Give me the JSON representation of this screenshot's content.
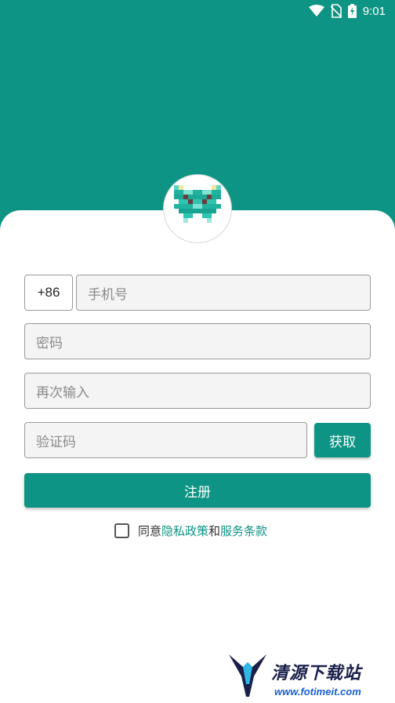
{
  "status_bar": {
    "time": "9:01",
    "icons": [
      "wifi-icon",
      "no-sim-icon",
      "battery-charging-icon"
    ]
  },
  "colors": {
    "primary": "#0e9484",
    "link": "#0e9484"
  },
  "form": {
    "country_code": "+86",
    "phone_placeholder": "手机号",
    "password_placeholder": "密码",
    "confirm_placeholder": "再次输入",
    "code_placeholder": "验证码",
    "get_code_label": "获取",
    "register_label": "注册"
  },
  "agreement": {
    "prefix": "同意",
    "privacy_link": "隐私政策",
    "and": "和",
    "terms_link": "服务条款",
    "checked": false
  },
  "watermark": {
    "title": "清源下载站",
    "url": "www.fotimeit.com"
  }
}
